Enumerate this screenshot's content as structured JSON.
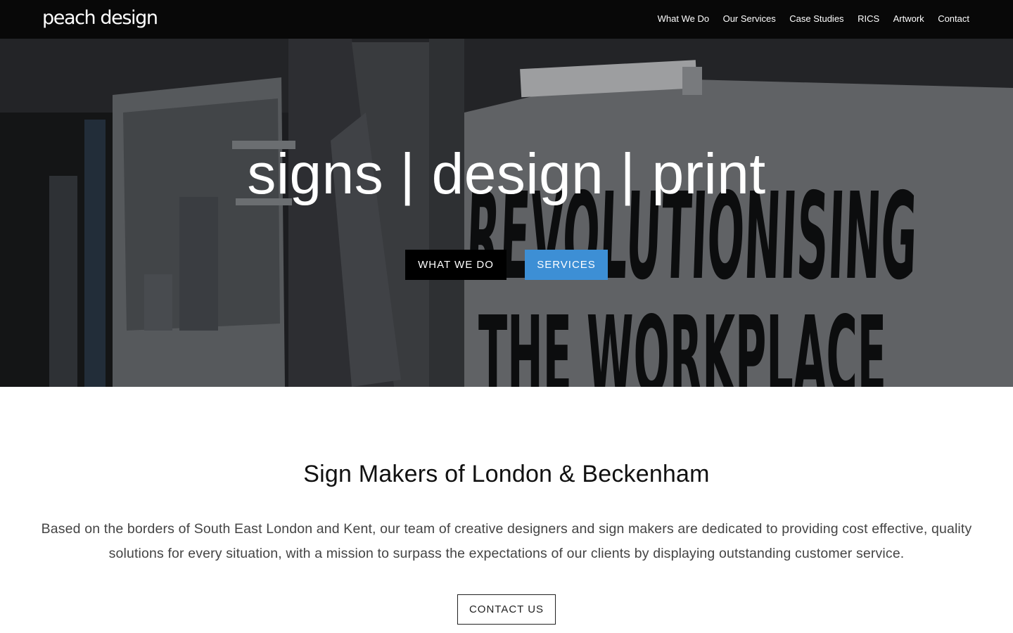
{
  "header": {
    "logo_text": "peach design",
    "nav": [
      {
        "label": "What We Do"
      },
      {
        "label": "Our Services"
      },
      {
        "label": "Case Studies"
      },
      {
        "label": "RICS"
      },
      {
        "label": "Artwork"
      },
      {
        "label": "Contact"
      }
    ]
  },
  "hero": {
    "headline": "signs | design | print",
    "background_sign_text": "REVOLUTIONISING THE WORKPLACE",
    "buttons": {
      "what_we_do": "WHAT WE DO",
      "services": "SERVICES"
    }
  },
  "intro": {
    "title": "Sign Makers of London & Beckenham",
    "paragraph": "Based on the borders of South East London and Kent, our team of creative designers and sign makers are dedicated to providing cost effective, quality solutions for every situation, with a mission to surpass the expectations of our clients by displaying outstanding customer service.",
    "contact_button": "CONTACT US"
  },
  "colors": {
    "header_bg": "#080808",
    "services_button": "#3d8fd5",
    "what_we_do_button": "#000000",
    "body_text": "#444444"
  },
  "icons": []
}
